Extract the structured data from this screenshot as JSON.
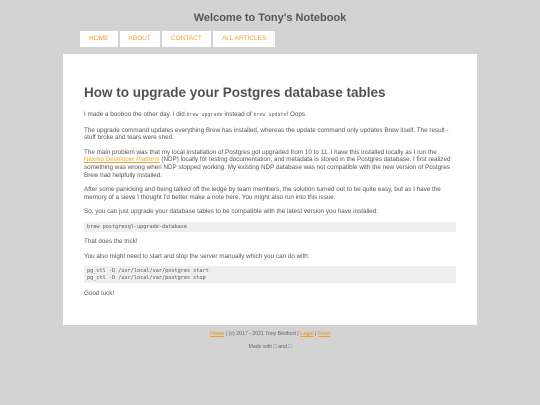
{
  "site": {
    "title": "Welcome to Tony's Notebook"
  },
  "nav": [
    {
      "label": "HOME"
    },
    {
      "label": "ABOUT"
    },
    {
      "label": "CONTACT"
    },
    {
      "label": "ALL ARTICLES"
    }
  ],
  "article": {
    "title": "How to upgrade your Postgres database tables",
    "p1_a": "I made a booboo the other day. I did ",
    "p1_code1": "brew upgrade",
    "p1_b": " instead of ",
    "p1_code2": "brew update",
    "p1_c": "! Oops.",
    "p2": "The upgrade command updates everything Brew has installed, whereas the update command only updates Brew itself. The result - stuff broke and tears were shed.",
    "p3_a": "The main problem was that my local installation of Postgres got upgraded from 10 to 11. I have this installed locally as I run the ",
    "p3_link": "Nexmo Developer Platform",
    "p3_b": " (NDP) locally for testing documentation, and metadata is stored in the Postgres database. I first realized something was wrong when NDP stopped working. My existing NDP database was not compatible with the new version of Postgres Brew had helpfully installed.",
    "p4": "After some panicking and being talked off the ledge by team members, the solution turned out to be quite easy, but as I have the memory of a sieve I thought I'd better make a note here. You might also run into this issue.",
    "p5": "So, you can just upgrade your database tables to be compatible with the latest version you have installed:",
    "code1": "brew postgresql-upgrade-database",
    "p6": "That does the trick!",
    "p7": "You also might need to start and stop the server manually which you can do with:",
    "code2": "pg_ctl -D /usr/local/var/postgres start\npg_ctl -D /usr/local/var/postgres stop",
    "p8": "Good luck!"
  },
  "footer": {
    "home": "Home",
    "copyright": " | (c) 2017 - 2021 Tony Bedford | ",
    "legal": "Legal",
    "sep": " | ",
    "feed": "Feed",
    "made": "Made with □ and □"
  }
}
